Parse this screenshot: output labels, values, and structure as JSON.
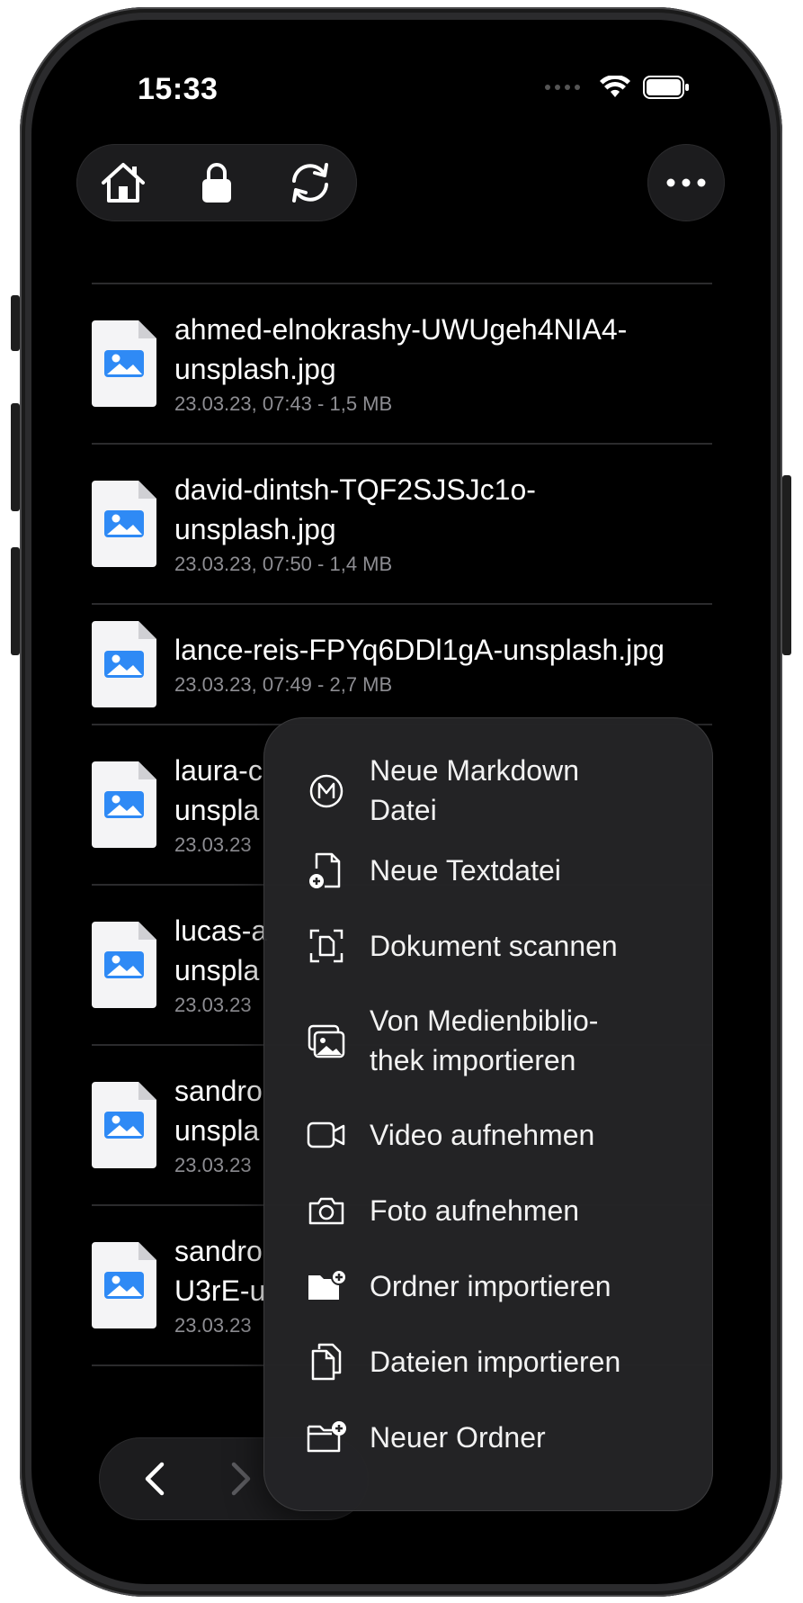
{
  "status": {
    "time": "15:33"
  },
  "toolbar": {
    "home": "home-icon",
    "lock": "lock-icon",
    "sync": "sync-icon",
    "more": "ellipsis-icon"
  },
  "files": [
    {
      "name": "ahmed-elnokrashy-UWUgeh4NIA4-unsplash.jpg",
      "name_line1": "ahmed-elnokrashy-UWUgeh4NIA4-",
      "name_line2": "unsplash.jpg",
      "meta": "23.03.23, 07:43 - 1,5 MB"
    },
    {
      "name": "david-dintsh-TQF2SJSJc1o-unsplash.jpg",
      "name_line1": "david-dintsh-TQF2SJSJc1o-",
      "name_line2": "unsplash.jpg",
      "meta": "23.03.23, 07:50 - 1,4 MB"
    },
    {
      "name": "lance-reis-FPYq6DDl1gA-unsplash.jpg",
      "name_line1": "lance-reis-FPYq6DDl1gA-unsplash.jpg",
      "name_line2": "",
      "meta": "23.03.23, 07:49 - 2,7 MB"
    },
    {
      "name_line1": "laura-c",
      "name_line2": "unspla",
      "meta": "23.03.23"
    },
    {
      "name_line1": "lucas-a",
      "name_line2": "unspla",
      "meta": "23.03.23"
    },
    {
      "name_line1": "sandro",
      "name_line2": "unspla",
      "meta": "23.03.23"
    },
    {
      "name_line1": "sandro",
      "name_line2": "U3rE-u",
      "meta": "23.03.23"
    }
  ],
  "menu": {
    "items": [
      {
        "label_line1": "Neue Markdown",
        "label_line2": "Datei",
        "icon": "markdown-icon"
      },
      {
        "label_line1": "Neue Textdatei",
        "label_line2": "",
        "icon": "new-doc-icon"
      },
      {
        "label_line1": "Dokument scannen",
        "label_line2": "",
        "icon": "scan-icon"
      },
      {
        "label_line1": "Von Medienbiblio-",
        "label_line2": "thek importieren",
        "icon": "photos-icon"
      },
      {
        "label_line1": "Video aufnehmen",
        "label_line2": "",
        "icon": "video-icon"
      },
      {
        "label_line1": "Foto aufnehmen",
        "label_line2": "",
        "icon": "camera-icon"
      },
      {
        "label_line1": "Ordner importieren",
        "label_line2": "",
        "icon": "folder-import-icon"
      },
      {
        "label_line1": "Dateien importieren",
        "label_line2": "",
        "icon": "files-icon"
      },
      {
        "label_line1": "Neuer Ordner",
        "label_line2": "",
        "icon": "new-folder-icon"
      }
    ]
  },
  "nav": {
    "back": "chevron-left-icon",
    "forward": "chevron-right-icon"
  },
  "colors": {
    "accent": "#2f8af5",
    "background": "#000000",
    "menu": "#242426",
    "meta": "#8e8e93"
  }
}
